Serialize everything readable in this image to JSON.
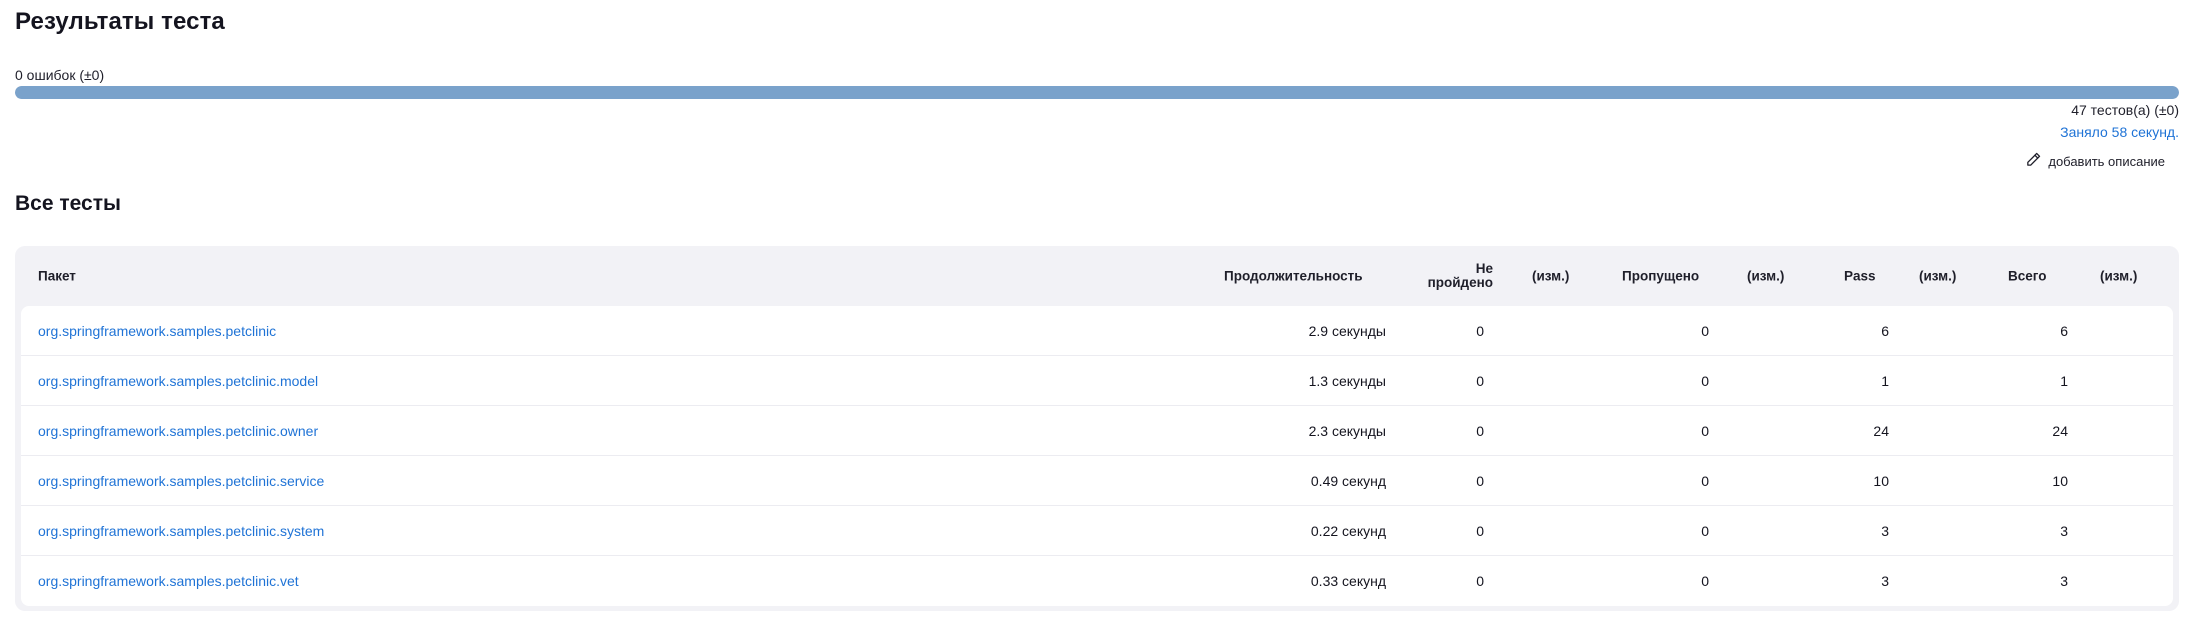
{
  "page_title": "Результаты теста",
  "summary": {
    "failures_text": "0 ошибок (±0)",
    "pass_fraction": 1.0,
    "tests_text": "47 тестов(а) (±0)",
    "duration_text": "Заняло 58 секунд.",
    "add_description_label": "добавить описание",
    "progress_color": "#7aa2cb",
    "link_color": "#1f73d6"
  },
  "section_title": "Все тесты",
  "table": {
    "headers": {
      "package": "Пакет",
      "duration": "Продолжительность",
      "failed_line1": "Не",
      "failed_line2": "пройдено",
      "failed_diff": "(изм.)",
      "skipped": "Пропущено",
      "skipped_diff": "(изм.)",
      "pass": "Pass",
      "pass_diff": "(изм.)",
      "total": "Всего",
      "total_diff": "(изм.)"
    },
    "rows": [
      {
        "package": "org.springframework.samples.petclinic",
        "duration": "2.9 секунды",
        "failed": "0",
        "skipped": "0",
        "pass": "6",
        "total": "6"
      },
      {
        "package": "org.springframework.samples.petclinic.model",
        "duration": "1.3 секунды",
        "failed": "0",
        "skipped": "0",
        "pass": "1",
        "total": "1"
      },
      {
        "package": "org.springframework.samples.petclinic.owner",
        "duration": "2.3 секунды",
        "failed": "0",
        "skipped": "0",
        "pass": "24",
        "total": "24"
      },
      {
        "package": "org.springframework.samples.petclinic.service",
        "duration": "0.49 секунд",
        "failed": "0",
        "skipped": "0",
        "pass": "10",
        "total": "10"
      },
      {
        "package": "org.springframework.samples.petclinic.system",
        "duration": "0.22 секунд",
        "failed": "0",
        "skipped": "0",
        "pass": "3",
        "total": "3"
      },
      {
        "package": "org.springframework.samples.petclinic.vet",
        "duration": "0.33 секунд",
        "failed": "0",
        "skipped": "0",
        "pass": "3",
        "total": "3"
      }
    ]
  }
}
